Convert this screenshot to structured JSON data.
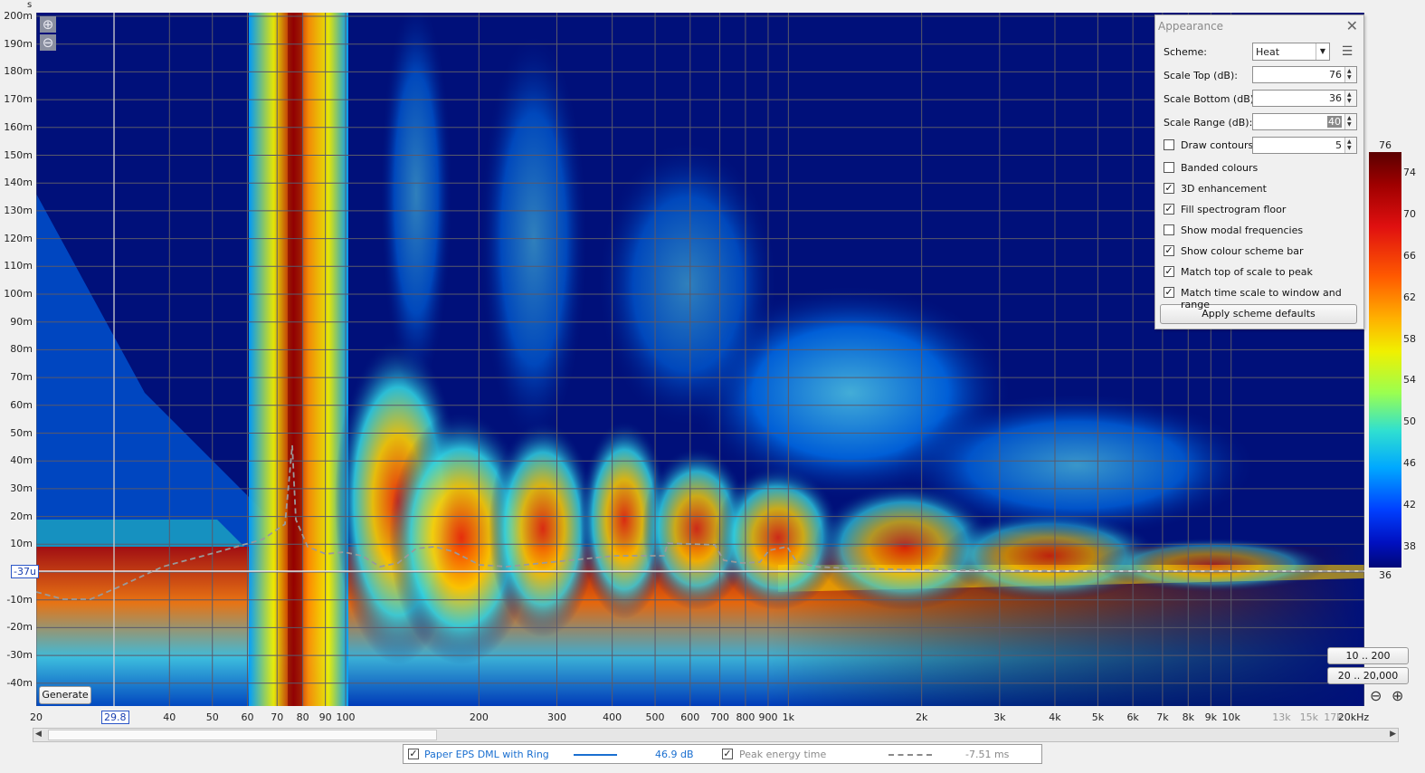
{
  "plot": {
    "y_unit": "s",
    "y_ticks": [
      "200m",
      "190m",
      "180m",
      "170m",
      "160m",
      "150m",
      "140m",
      "130m",
      "120m",
      "110m",
      "100m",
      "90m",
      "80m",
      "70m",
      "60m",
      "50m",
      "40m",
      "30m",
      "20m",
      "10m",
      "-10m",
      "-20m",
      "-30m",
      "-40m"
    ],
    "cursor_y": "-37u",
    "cursor_x": "29.8",
    "x_ticks": [
      "20",
      "40",
      "50",
      "60",
      "70",
      "80",
      "90",
      "100",
      "200",
      "300",
      "400",
      "500",
      "600",
      "700",
      "800",
      "900",
      "1k",
      "2k",
      "3k",
      "4k",
      "5k",
      "6k",
      "7k",
      "8k",
      "9k",
      "10k"
    ],
    "x_ticks_dim": [
      "13k",
      "15k",
      "17k"
    ],
    "x_end": "20kHz",
    "zoom_in_icon": "zoom-in-icon",
    "zoom_out_icon": "zoom-out-icon",
    "generate_label": "Generate"
  },
  "appearance": {
    "title": "Appearance",
    "scheme_label": "Scheme:",
    "scheme_value": "Heat",
    "scale_top_label": "Scale Top (dB):",
    "scale_top_value": "76",
    "scale_bottom_label": "Scale Bottom (dB):",
    "scale_bottom_value": "36",
    "scale_range_label": "Scale Range (dB):",
    "scale_range_value": "40",
    "draw_contours_label": "Draw contours",
    "draw_contours_value": "5",
    "options": [
      {
        "label": "Banded colours",
        "checked": false
      },
      {
        "label": "3D enhancement",
        "checked": true
      },
      {
        "label": "Fill spectrogram floor",
        "checked": true
      },
      {
        "label": "Show modal frequencies",
        "checked": false
      },
      {
        "label": "Show colour scheme bar",
        "checked": true
      },
      {
        "label": "Match top of scale to peak",
        "checked": true
      },
      {
        "label": "Match time scale to window and range",
        "checked": true
      }
    ],
    "apply_label": "Apply scheme defaults"
  },
  "colorbar": {
    "top": "76",
    "bottom": "36",
    "ticks": [
      "74",
      "70",
      "66",
      "62",
      "58",
      "54",
      "50",
      "46",
      "42",
      "38"
    ]
  },
  "range_buttons": {
    "y_range": "10 .. 200",
    "x_range": "20 .. 20,000"
  },
  "legend": {
    "items": [
      {
        "name": "Paper EPS DML with Ring",
        "value": "46.9 dB",
        "color": "#1a6fd0",
        "checked": true
      },
      {
        "name": "Peak energy time",
        "value": "-7.51 ms",
        "color": "#8a8a8a",
        "checked": true
      }
    ]
  }
}
